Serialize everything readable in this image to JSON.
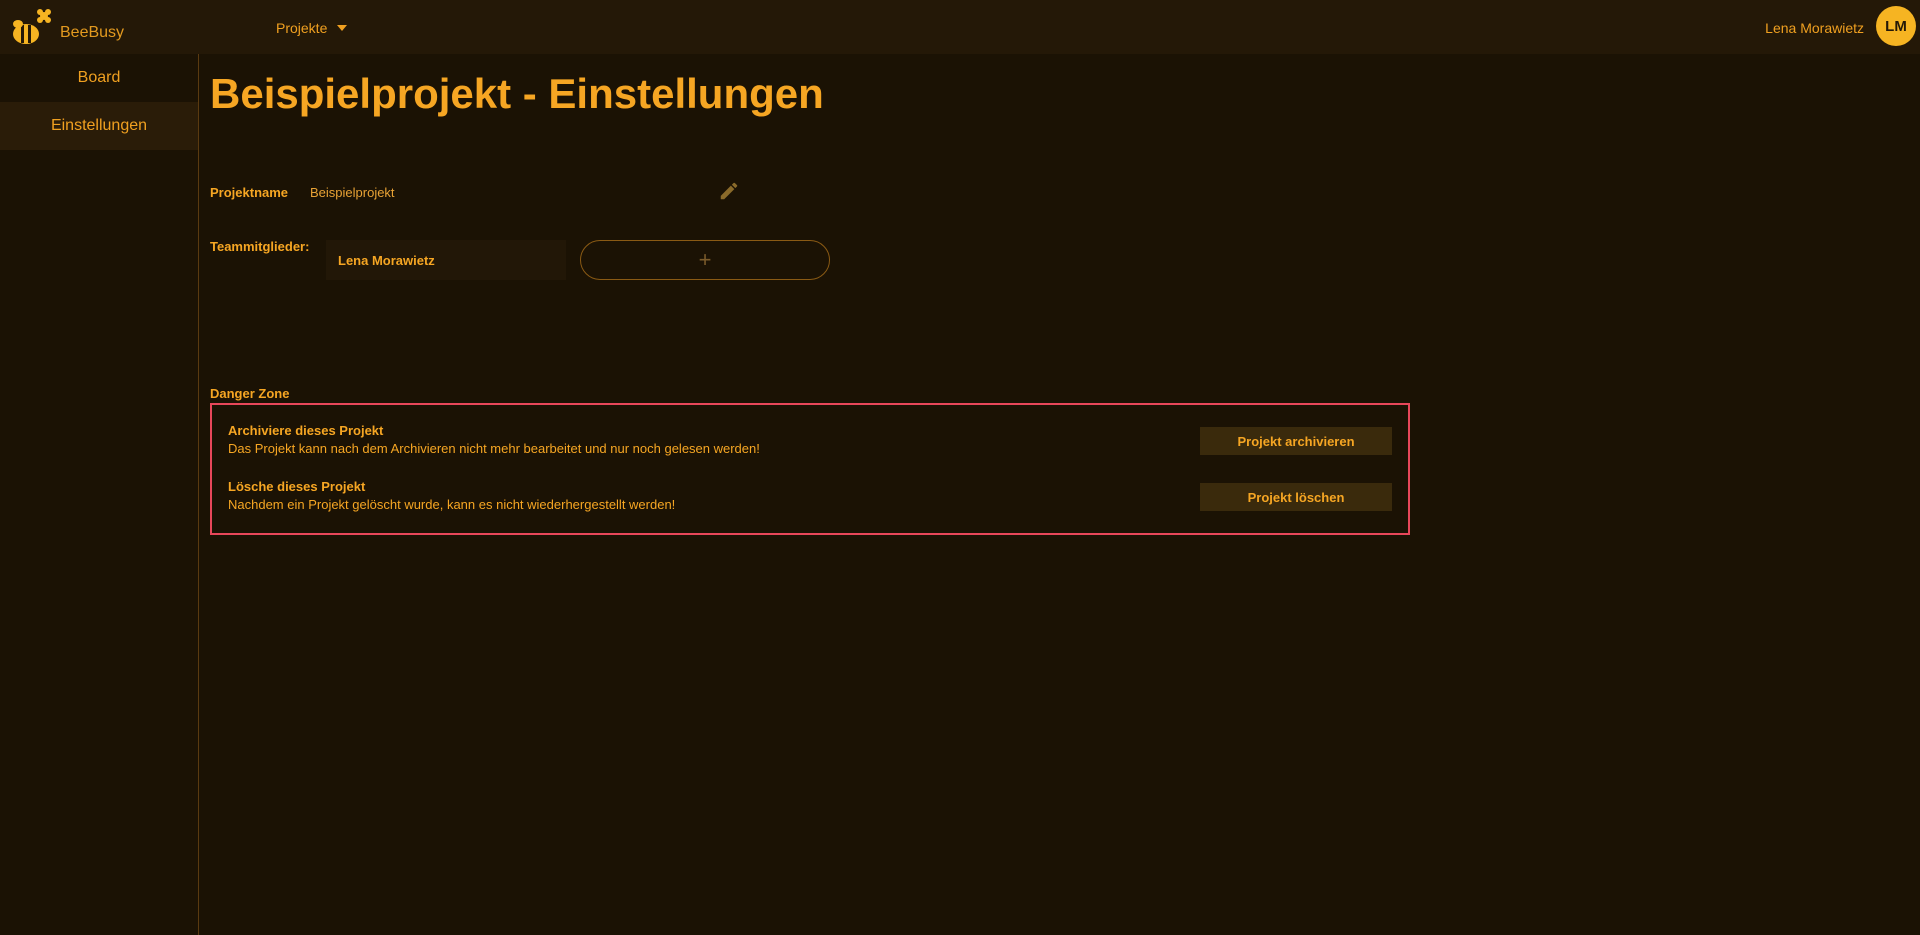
{
  "header": {
    "brand": "BeeBusy",
    "projects_label": "Projekte",
    "user_name": "Lena Morawietz",
    "user_initials": "LM"
  },
  "sidebar": {
    "items": [
      {
        "label": "Board",
        "active": false
      },
      {
        "label": "Einstellungen",
        "active": true
      }
    ]
  },
  "main": {
    "title": "Beispielprojekt - Einstellungen",
    "project_name_label": "Projektname",
    "project_name_value": "Beispielprojekt",
    "team_label": "Teammitglieder:",
    "team_members": [
      "Lena Morawietz"
    ],
    "add_member_symbol": "+",
    "danger_zone": {
      "label": "Danger Zone",
      "archive": {
        "heading": "Archiviere dieses Projekt",
        "description": "Das Projekt kann nach dem Archivieren nicht mehr bearbeitet und nur noch gelesen werden!",
        "button": "Projekt archivieren"
      },
      "delete": {
        "heading": "Lösche dieses Projekt",
        "description": "Nachdem ein Projekt gelöscht wurde, kann es nicht wiederhergestellt werden!",
        "button": "Projekt löschen"
      }
    }
  },
  "colors": {
    "background": "#1b1204",
    "accent": "#f6a623",
    "danger_border": "#e8475a"
  }
}
